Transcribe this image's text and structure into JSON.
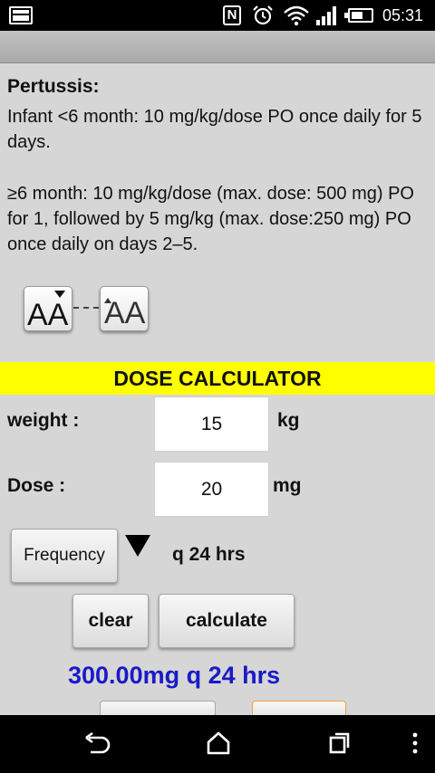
{
  "status_bar": {
    "time": "05:31"
  },
  "content": {
    "heading": "Pertussis:",
    "paragraph_1": "Infant <6 month: 10 mg/kg/dose PO once daily for 5 days.",
    "paragraph_2": "≥6 month: 10 mg/kg/dose (max. dose: 500 mg) PO for 1, followed by 5 mg/kg (max. dose:250 mg) PO once daily on days 2–5."
  },
  "font_controls": {
    "decrease_glyph": "AA",
    "increase_glyph": "AA"
  },
  "calculator": {
    "title": "DOSE CALCULATOR",
    "weight_label": "weight :",
    "weight_value": "15",
    "weight_unit": "kg",
    "dose_label": "Dose :",
    "dose_value": "20",
    "dose_unit": "mg",
    "frequency_button": "Frequency",
    "frequency_value": "q 24 hrs",
    "clear_label": "clear",
    "calculate_label": "calculate",
    "result": "300.00mg q 24 hrs"
  },
  "colors": {
    "banner": "#ffff00",
    "result": "#1a1ac8",
    "background": "#d6d6d6"
  }
}
